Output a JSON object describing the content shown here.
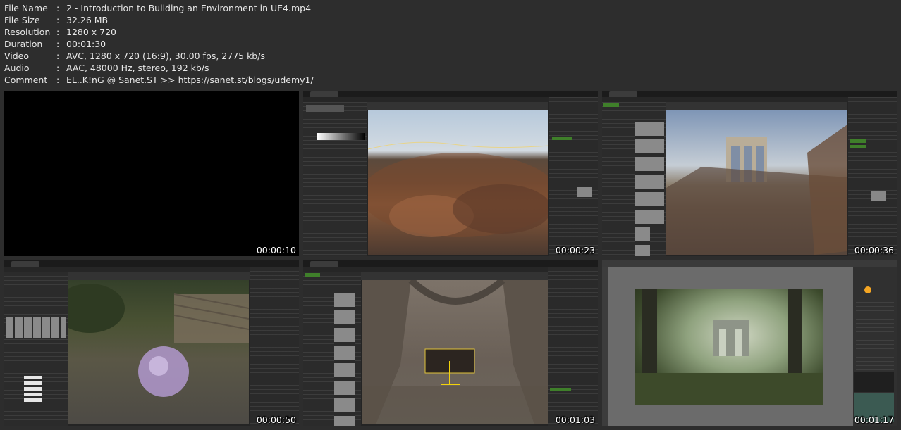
{
  "metadata": [
    {
      "key": "File Name",
      "sep": ":",
      "value": "2 - Introduction to Building an Environment in UE4.mp4"
    },
    {
      "key": "File Size",
      "sep": ":",
      "value": "32.26 MB"
    },
    {
      "key": "Resolution",
      "sep": ":",
      "value": "1280 x 720"
    },
    {
      "key": "Duration",
      "sep": ":",
      "value": "00:01:30"
    },
    {
      "key": "Video",
      "sep": ":",
      "value": "AVC, 1280 x 720 (16:9), 30.00 fps, 2775 kb/s"
    },
    {
      "key": "Audio",
      "sep": ":",
      "value": "AAC, 48000 Hz, stereo, 192 kb/s"
    },
    {
      "key": "Comment",
      "sep": ":",
      "value": "EL..K!nG @ Sanet.ST >> https://sanet.st/blogs/udemy1/"
    }
  ],
  "thumbnails": [
    {
      "timestamp": "00:00:10"
    },
    {
      "timestamp": "00:00:23"
    },
    {
      "timestamp": "00:00:36"
    },
    {
      "timestamp": "00:00:50"
    },
    {
      "timestamp": "00:01:03"
    },
    {
      "timestamp": "00:01:17"
    }
  ]
}
